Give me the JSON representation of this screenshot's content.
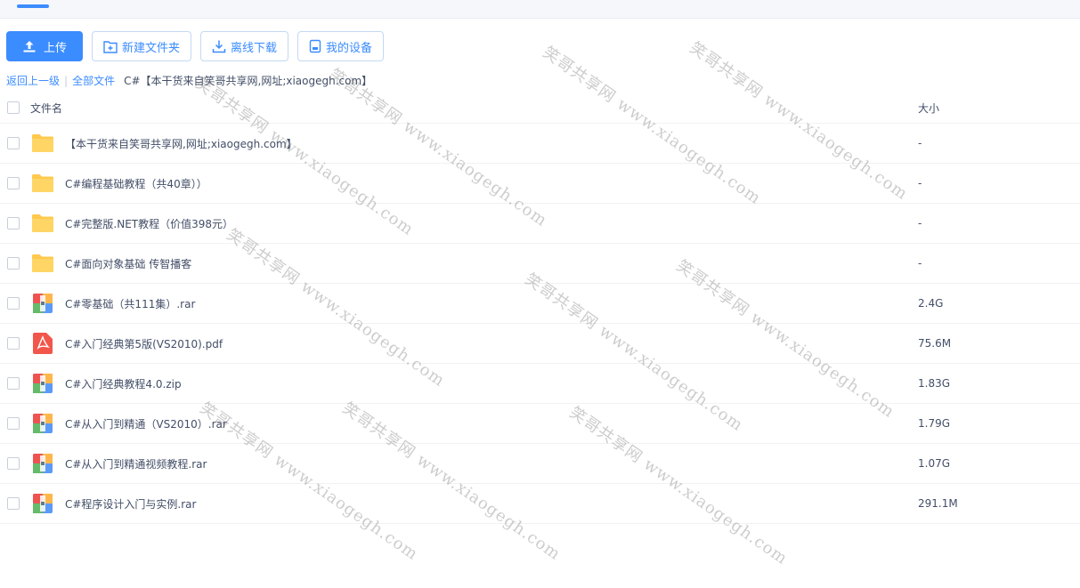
{
  "toolbar": {
    "upload": "上传",
    "new_folder": "新建文件夹",
    "offline_download": "离线下载",
    "my_devices": "我的设备"
  },
  "breadcrumb": {
    "back": "返回上一级",
    "all_files": "全部文件",
    "current": "C#【本干货来自笑哥共享网,网址;xiaogegh.com】"
  },
  "table": {
    "col_name": "文件名",
    "col_size": "大小",
    "rows": [
      {
        "name": "【本干货来自笑哥共享网,网址;xiaogegh.com】",
        "size": "-",
        "type": "folder"
      },
      {
        "name": "C#编程基础教程（共40章））",
        "size": "-",
        "type": "folder"
      },
      {
        "name": "C#完整版.NET教程（价值398元）",
        "size": "-",
        "type": "folder"
      },
      {
        "name": "C#面向对象基础 传智播客",
        "size": "-",
        "type": "folder"
      },
      {
        "name": "C#零基础（共111集）.rar",
        "size": "2.4G",
        "type": "archive"
      },
      {
        "name": "C#入门经典第5版(VS2010).pdf",
        "size": "75.6M",
        "type": "pdf"
      },
      {
        "name": "C#入门经典教程4.0.zip",
        "size": "1.83G",
        "type": "archive"
      },
      {
        "name": "C#从入门到精通（VS2010）.rar",
        "size": "1.79G",
        "type": "archive"
      },
      {
        "name": "C#从入门到精通视频教程.rar",
        "size": "1.07G",
        "type": "archive"
      },
      {
        "name": "C#程序设计入门与实例.rar",
        "size": "291.1M",
        "type": "archive"
      }
    ]
  },
  "watermark": "笑哥共享网 www.xiaogegh.com",
  "colors": {
    "accent": "#3b8cff",
    "folder": "#ffc94d",
    "pdf": "#f2564b"
  }
}
